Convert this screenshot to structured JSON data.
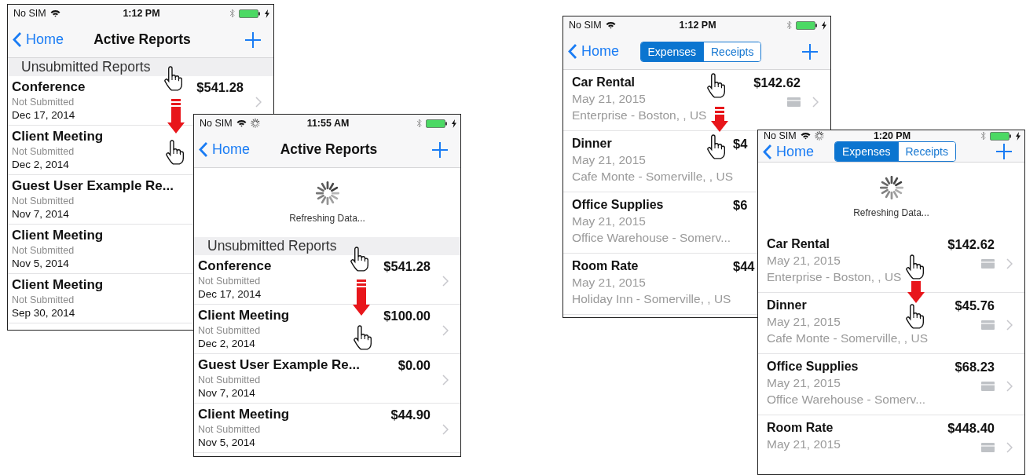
{
  "screens": [
    {
      "kind": "reports",
      "status": {
        "carrier": "No SIM",
        "time": "1:12 PM",
        "network_activity": false
      },
      "nav": {
        "back": "Home",
        "title": "Active Reports"
      },
      "section": "Unsubmitted Reports",
      "rows": [
        {
          "title": "Conference",
          "status": "Not Submitted",
          "date": "Dec 17, 2014",
          "amount": "$541.28",
          "chevron": true
        },
        {
          "title": "Client Meeting",
          "status": "Not Submitted",
          "date": "Dec 2, 2014"
        },
        {
          "title": "Guest User Example Re...",
          "status": "Not Submitted",
          "date": "Nov 7, 2014"
        },
        {
          "title": "Client Meeting",
          "status": "Not Submitted",
          "date": "Nov 5, 2014"
        },
        {
          "title": "Client Meeting",
          "status": "Not Submitted",
          "date": "Sep 30, 2014"
        }
      ]
    },
    {
      "kind": "reports",
      "status": {
        "carrier": "No SIM",
        "time": "11:55 AM",
        "network_activity": true
      },
      "nav": {
        "back": "Home",
        "title": "Active Reports"
      },
      "refresh": "Refreshing Data...",
      "section": "Unsubmitted Reports",
      "rows": [
        {
          "title": "Conference",
          "status": "Not Submitted",
          "date": "Dec 17, 2014",
          "amount": "$541.28",
          "chevron": true
        },
        {
          "title": "Client Meeting",
          "status": "Not Submitted",
          "date": "Dec 2, 2014",
          "amount": "$100.00",
          "chevron": true
        },
        {
          "title": "Guest User Example Re...",
          "status": "Not Submitted",
          "date": "Nov 7, 2014",
          "amount": "$0.00",
          "chevron": true
        },
        {
          "title": "Client Meeting",
          "status": "Not Submitted",
          "date": "Nov 5, 2014",
          "amount": "$44.90",
          "chevron": true
        }
      ]
    },
    {
      "kind": "expenses",
      "status": {
        "carrier": "No SIM",
        "time": "1:12 PM",
        "network_activity": false
      },
      "nav": {
        "back": "Home",
        "segments": [
          {
            "label": "Expenses",
            "selected": true
          },
          {
            "label": "Receipts",
            "selected": false
          }
        ]
      },
      "rows": [
        {
          "title": "Car Rental",
          "date": "May 21, 2015",
          "vendor": "Enterprise - Boston, , US",
          "amount": "$142.62",
          "receipt": true,
          "chevron": true
        },
        {
          "title": "Dinner",
          "date": "May 21, 2015",
          "vendor": "Cafe Monte - Somerville, , US",
          "amount": "$4",
          "amount_cut": true
        },
        {
          "title": "Office Supplies",
          "date": "May 21, 2015",
          "vendor": "Office Warehouse - Somerv...",
          "amount": "$6",
          "amount_cut": true
        },
        {
          "title": "Room Rate",
          "date": "May 21, 2015",
          "vendor": "Holiday Inn - Somerville, , US",
          "amount": "$44",
          "amount_cut": true
        }
      ]
    },
    {
      "kind": "expenses",
      "status": {
        "carrier": "No SIM",
        "time": "1:20 PM",
        "network_activity": true
      },
      "nav": {
        "back": "Home",
        "segments": [
          {
            "label": "Expenses",
            "selected": true
          },
          {
            "label": "Receipts",
            "selected": false
          }
        ]
      },
      "refresh": "Refreshing Data...",
      "rows": [
        {
          "title": "Car Rental",
          "date": "May 21, 2015",
          "vendor": "Enterprise - Boston, , US",
          "amount": "$142.62",
          "receipt": true,
          "chevron": true
        },
        {
          "title": "Dinner",
          "date": "May 21, 2015",
          "vendor": "Cafe Monte - Somerville, , US",
          "amount": "$45.76",
          "receipt": true,
          "chevron": true
        },
        {
          "title": "Office Supplies",
          "date": "May 21, 2015",
          "vendor": "Office Warehouse - Somerv...",
          "amount": "$68.23",
          "receipt": true,
          "chevron": true
        },
        {
          "title": "Room Rate",
          "date": "May 21, 2015",
          "amount": "$448.40",
          "receipt": true,
          "chevron": true
        }
      ]
    }
  ]
}
